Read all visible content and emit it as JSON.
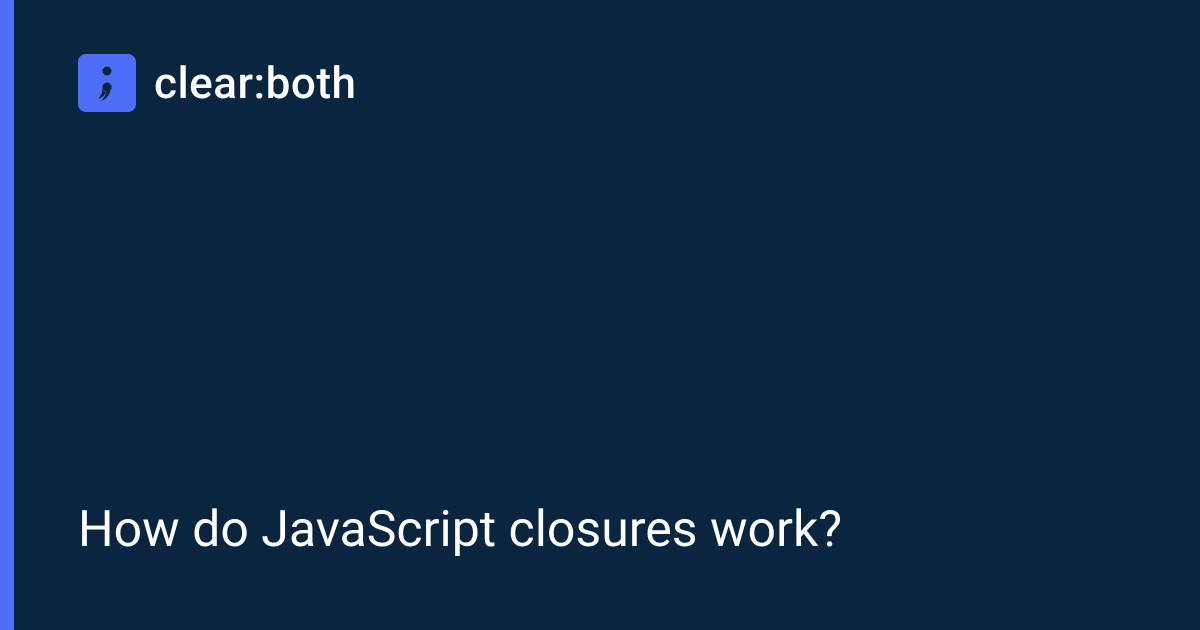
{
  "brand": {
    "name": "clear:both"
  },
  "title": "How do JavaScript closures work?",
  "colors": {
    "background": "#0a2540",
    "accent": "#4f6ef7",
    "text": "#ffffff"
  }
}
